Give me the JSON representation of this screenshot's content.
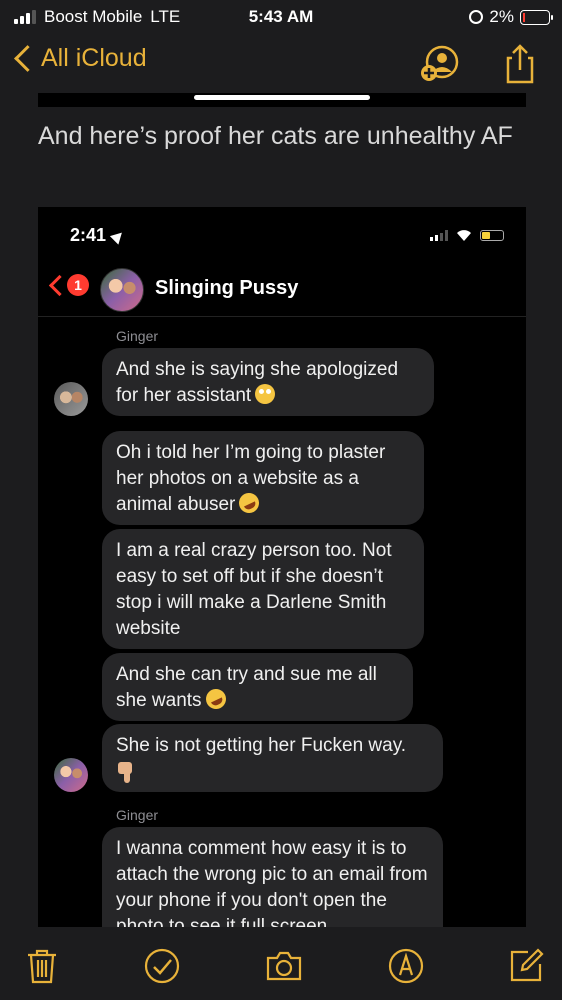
{
  "status_bar": {
    "carrier": "Boost Mobile",
    "network": "LTE",
    "time": "5:43 AM",
    "battery": "2%"
  },
  "nav": {
    "back_label": "All iCloud",
    "icons": [
      "add-person-icon",
      "share-icon"
    ],
    "accent_color": "#e8b23a"
  },
  "note": {
    "text": "And here’s proof her cats are unhealthy AF"
  },
  "screenshot": {
    "status_time": "2:41",
    "contact_name": "Slinging Pussy",
    "back_badge": "1",
    "messages": [
      {
        "sender": "Ginger",
        "text": "And she is saying she apologized for her assistant"
      },
      {
        "text": "Oh i told her I’m going to plaster her photos on a website as a animal abuser"
      },
      {
        "text": "I am a real crazy person too. Not easy to set off but if she doesn’t stop i will make a Darlene Smith website"
      },
      {
        "text": "And she can try and sue me all she wants"
      },
      {
        "text": "She is not getting her Fucken way."
      },
      {
        "sender": "Ginger",
        "text": "I wanna comment how easy it is to attach the wrong pic to an email from your phone if you don't open the photo to see it full screen"
      }
    ]
  },
  "toolbar": {
    "icons": [
      "trash-icon",
      "checklist-icon",
      "camera-icon",
      "markup-icon",
      "compose-icon"
    ]
  }
}
